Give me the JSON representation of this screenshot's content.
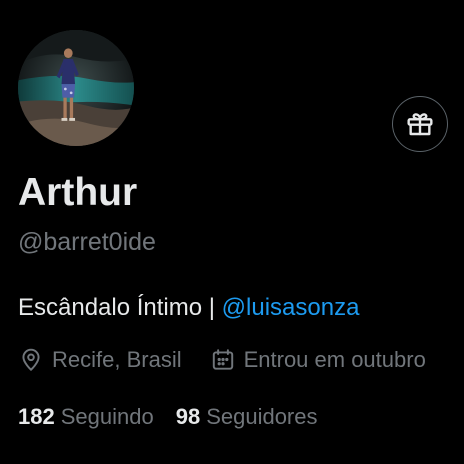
{
  "profile": {
    "display_name": "Arthur",
    "handle": "@barret0ide",
    "bio_text": "Escândalo Íntimo | ",
    "bio_mention": "@luisasonza",
    "location": "Recife, Brasil",
    "joined": "Entrou em outubro"
  },
  "stats": {
    "following_count": "182",
    "following_label": "Seguindo",
    "followers_count": "98",
    "followers_label": "Seguidores"
  },
  "icons": {
    "gift": "gift-icon",
    "location": "location-pin-icon",
    "calendar": "calendar-icon"
  },
  "colors": {
    "background": "#000000",
    "primary_text": "#e7e9ea",
    "secondary_text": "#71767b",
    "link": "#1d9bf0"
  }
}
